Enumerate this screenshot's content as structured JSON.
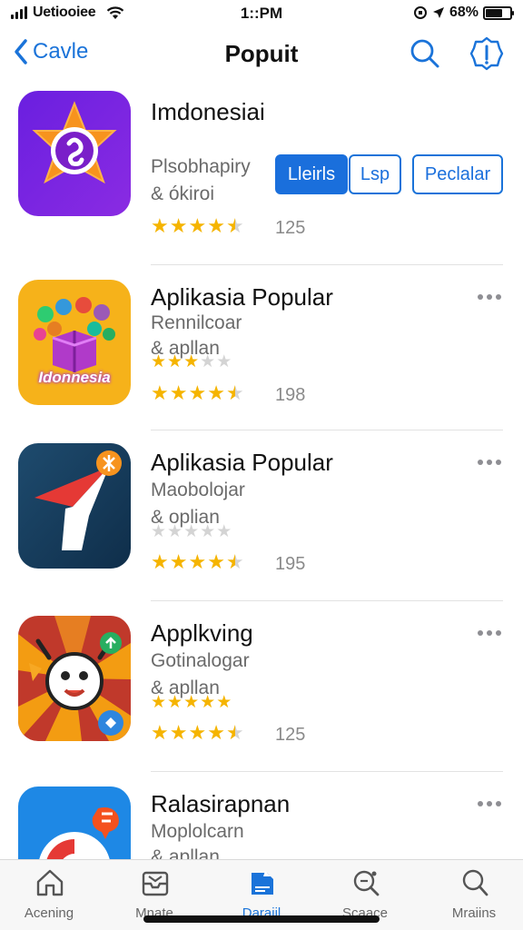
{
  "status_bar": {
    "carrier": "Uetiooiee",
    "time": "1::PM",
    "battery": "68%",
    "battery_level": 0.68
  },
  "nav": {
    "back_label": "Cavle",
    "title": "Popuit",
    "icons": [
      "chevron-left-icon",
      "search-icon",
      "info-icon"
    ]
  },
  "apps": [
    {
      "name": "Imdonesiai",
      "sub1": "Plsobhapiry",
      "sub2": "& ókiroi",
      "rating": 4.5,
      "count": "125",
      "buttons": [
        "Lleirls",
        "Lsp",
        "Peclalar"
      ]
    },
    {
      "name": "Aplikasia Popular",
      "sub1": "Rennilcoar",
      "sub2": "& apllan",
      "rating": 4.5,
      "secondary_rating": 3,
      "count": "198",
      "icon_text": "Idonnesia"
    },
    {
      "name": "Aplikasia Popular",
      "sub1": "Maobolojar",
      "sub2": "& oplian",
      "rating": 4.5,
      "secondary_rating": 0,
      "count": "195"
    },
    {
      "name": "Applkving",
      "sub1": "Gotinalogar",
      "sub2": "& apllan",
      "rating": 4.5,
      "secondary_rating": 5,
      "count": "125"
    },
    {
      "name": "Ralasirapnan",
      "sub1": "Moplolcarn",
      "sub2": "& apllan"
    }
  ],
  "tabs": [
    {
      "label": "Acening",
      "icon": "home-icon"
    },
    {
      "label": "Mnate",
      "icon": "inbox-icon"
    },
    {
      "label": "Daraiil",
      "icon": "apps-icon",
      "active": true
    },
    {
      "label": "Scaace",
      "icon": "search-plus-icon"
    },
    {
      "label": "Mraiins",
      "icon": "search-icon"
    }
  ],
  "colors": {
    "accent": "#1a73d9",
    "star": "#f5b400",
    "star_empty": "#d4d4d4"
  }
}
